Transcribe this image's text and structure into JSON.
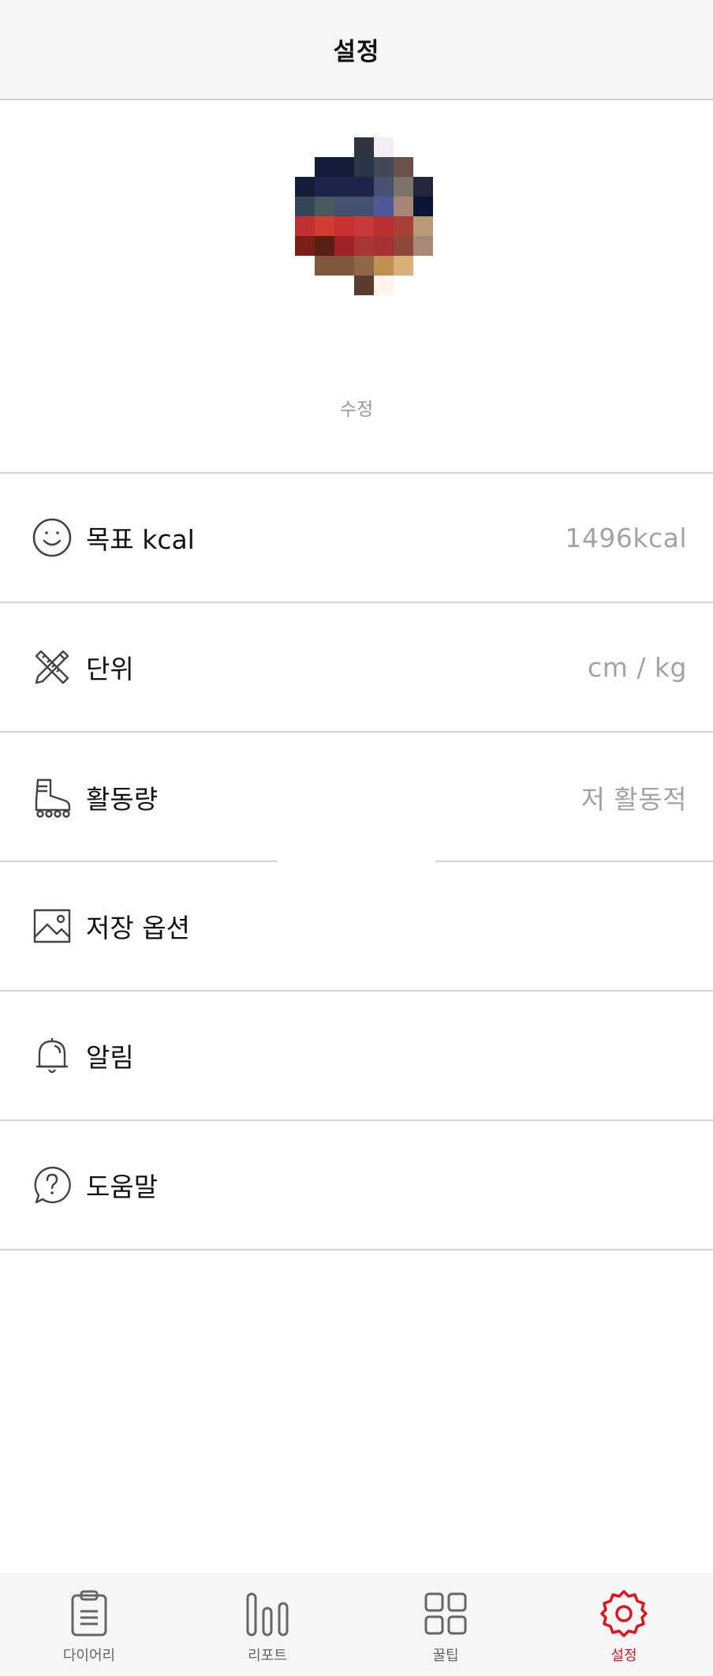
{
  "header": {
    "title": "설정"
  },
  "profile": {
    "edit_label": "수정",
    "avatar_pixels": [
      [
        "",
        "",
        "",
        "#2e3440",
        "#f4eef4",
        "",
        ""
      ],
      [
        "",
        "#141c3c",
        "#141c3c",
        "#2c3448",
        "#404858",
        "#6a5048",
        ""
      ],
      [
        "#141c3c",
        "#1c2448",
        "#1c2448",
        "#1c2448",
        "#485070",
        "#7a7468",
        "#24243a"
      ],
      [
        "#34465a",
        "#4a5a5c",
        "#445070",
        "#445070",
        "#4c5898",
        "#a88478",
        "#0a1434"
      ],
      [
        "#c03030",
        "#d03c30",
        "#c83030",
        "#c83838",
        "#b83030",
        "#a84038",
        "#b89c78"
      ],
      [
        "#782018",
        "#582014",
        "#a02024",
        "#a83434",
        "#a83030",
        "#8c4838",
        "#a88878"
      ],
      [
        "",
        "#80563c",
        "#80563c",
        "#8c6848",
        "#c09050",
        "#d8b078",
        ""
      ],
      [
        "",
        "",
        "",
        "#5a3c2c",
        "#fff4ec",
        "",
        ""
      ]
    ]
  },
  "settings": [
    {
      "key": "goal",
      "label": "목표 kcal",
      "value": "1496kcal",
      "icon": "smiley-icon"
    },
    {
      "key": "unit",
      "label": "단위",
      "value": "cm / kg",
      "icon": "ruler-pencil-icon"
    },
    {
      "key": "activity",
      "label": "활동량",
      "value": "저 활동적",
      "icon": "roller-skate-icon"
    },
    {
      "key": "storage",
      "label": "저장 옵션",
      "value": "",
      "icon": "image-icon"
    },
    {
      "key": "alarm",
      "label": "알림",
      "value": "",
      "icon": "bell-icon"
    },
    {
      "key": "help",
      "label": "도움말",
      "value": "",
      "icon": "help-question-icon"
    }
  ],
  "nav": {
    "items": [
      {
        "label": "다이어리",
        "icon": "clipboard-icon",
        "active": false
      },
      {
        "label": "리포트",
        "icon": "bar-chart-icon",
        "active": false
      },
      {
        "label": "꿀팁",
        "icon": "grid-icon",
        "active": false
      },
      {
        "label": "설정",
        "icon": "gear-icon",
        "active": true
      }
    ]
  },
  "colors": {
    "accent": "#e0141e",
    "divider": "#d3d3d3",
    "value_text": "#a3a3a3"
  }
}
